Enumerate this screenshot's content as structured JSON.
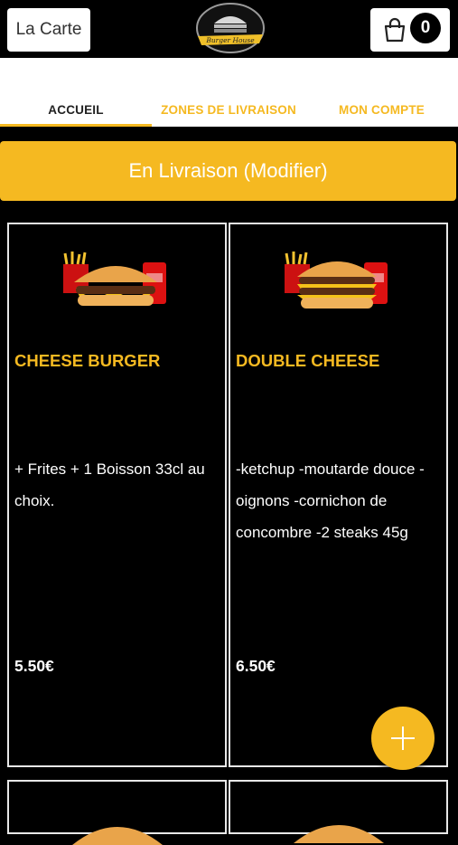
{
  "header": {
    "menu_label": "La Carte",
    "logo_text": "Burger House",
    "cart_count": "0"
  },
  "nav": {
    "tabs": [
      {
        "label": "ACCUEIL"
      },
      {
        "label": "ZONES DE LIVRAISON"
      },
      {
        "label": "MON COMPTE"
      }
    ]
  },
  "delivery": {
    "label": "En Livraison (Modifier)"
  },
  "products": [
    {
      "name": "CHEESE BURGER",
      "description": "+ Frites  + 1 Boisson 33cl au choix.",
      "price": "5.50€"
    },
    {
      "name": "DOUBLE CHEESE",
      "description": "-ketchup -moutarde douce -oignons  -cornichon de concombre -2 steaks 45g",
      "price": "6.50€"
    }
  ],
  "colors": {
    "accent": "#f5b921",
    "background": "#000000",
    "card_border": "#e8e8e8"
  },
  "icons": {
    "cart": "shopping-bag-icon",
    "fab": "plus-icon"
  }
}
